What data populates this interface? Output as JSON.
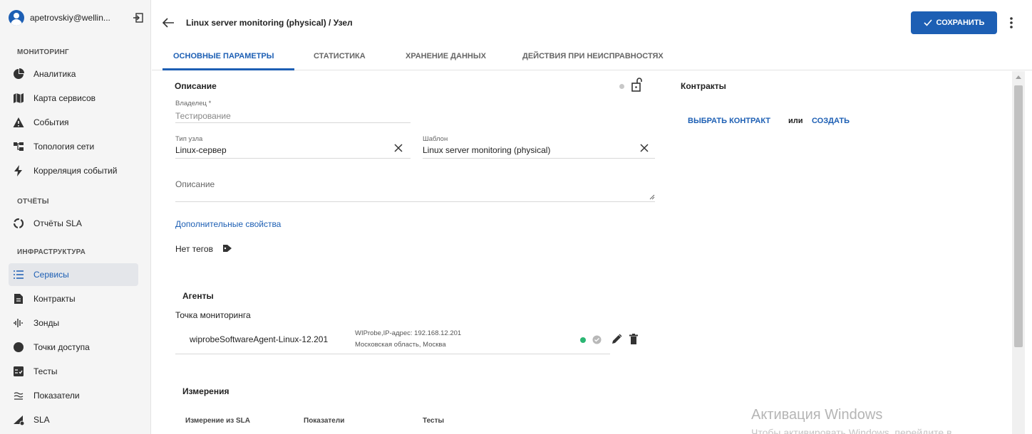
{
  "user": {
    "name": "apetrovskiy@wellin..."
  },
  "sidebar": {
    "sections": [
      {
        "title": "МОНИТОРИНГ"
      },
      {
        "title": "ОТЧЁТЫ"
      },
      {
        "title": "ИНФРАСТРУКТУРА"
      }
    ],
    "items": [
      {
        "label": "Аналитика",
        "icon": "pie-chart-icon"
      },
      {
        "label": "Карта сервисов",
        "icon": "map-icon"
      },
      {
        "label": "События",
        "icon": "warning-icon"
      },
      {
        "label": "Топология сети",
        "icon": "topology-icon"
      },
      {
        "label": "Корреляция событий",
        "icon": "lightning-icon"
      },
      {
        "label": "Отчёты SLA",
        "icon": "circle-progress-icon"
      },
      {
        "label": "Сервисы",
        "icon": "list-icon",
        "active": true
      },
      {
        "label": "Контракты",
        "icon": "document-icon"
      },
      {
        "label": "Зонды",
        "icon": "signal-icon"
      },
      {
        "label": "Точки доступа",
        "icon": "circle-icon"
      },
      {
        "label": "Тесты",
        "icon": "checklist-icon"
      },
      {
        "label": "Показатели",
        "icon": "approx-icon"
      },
      {
        "label": "SLA",
        "icon": "sla-icon"
      }
    ]
  },
  "header": {
    "title": "Linux server monitoring (physical) / Узел",
    "save_label": "СОХРАНИТЬ"
  },
  "tabs": [
    {
      "label": "ОСНОВНЫЕ ПАРАМЕТРЫ",
      "active": true
    },
    {
      "label": "СТАТИСТИКА"
    },
    {
      "label": "ХРАНЕНИЕ ДАННЫХ"
    },
    {
      "label": "ДЕЙСТВИЯ ПРИ НЕИСПРАВНОСТЯХ"
    }
  ],
  "description_section": {
    "title": "Описание",
    "owner_label": "Владелец *",
    "owner_value": "Тестирование",
    "node_type_label": "Тип узла",
    "node_type_value": "Linux-сервер",
    "template_label": "Шаблон",
    "template_value": "Linux server monitoring (physical)",
    "description_placeholder": "Описание",
    "extra_props_link": "Дополнительные свойства",
    "no_tags": "Нет тегов"
  },
  "contracts": {
    "title": "Контракты",
    "choose": "ВЫБРАТЬ КОНТРАКТ",
    "or": "или",
    "create": "СОЗДАТЬ"
  },
  "agents": {
    "title": "Агенты",
    "monitor_point": "Точка мониторинга",
    "agent_name": "wiprobeSoftwareAgent-Linux-12.201",
    "agent_info": "WIProbe,IP-адрес: 192.168.12.201",
    "agent_location": "Московская область, Москва",
    "status_color": "#2bb673"
  },
  "measurements": {
    "title": "Измерения",
    "columns": [
      "Измерение из SLA",
      "Показатели",
      "Тесты"
    ]
  },
  "watermark": {
    "line1": "Активация Windows",
    "line2": "Чтобы активировать Windows, перейдите в"
  },
  "colors": {
    "accent": "#1d5fb4"
  }
}
